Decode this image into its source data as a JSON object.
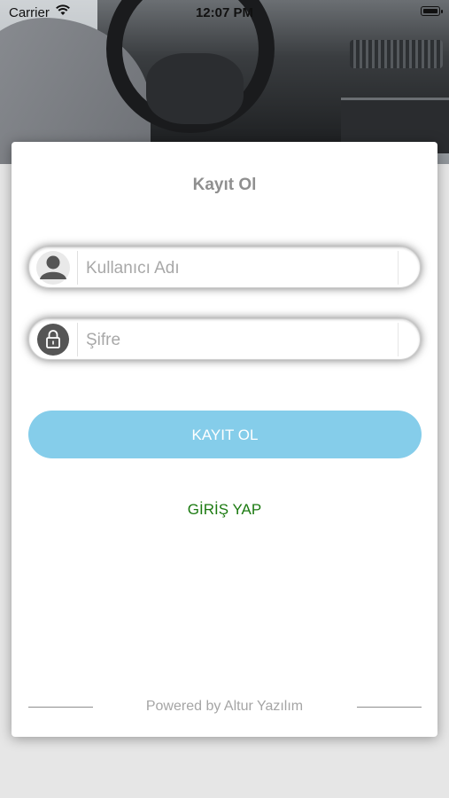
{
  "status_bar": {
    "carrier": "Carrier",
    "time": "12:07 PM",
    "wifi_icon": "wifi-icon",
    "battery_icon": "battery-icon"
  },
  "card": {
    "title": "Kayıt Ol",
    "username": {
      "placeholder": "Kullanıcı Adı",
      "value": "",
      "icon": "user-icon"
    },
    "password": {
      "placeholder": "Şifre",
      "value": "",
      "icon": "lock-icon"
    },
    "register_button": "KAYIT OL",
    "login_link": "GİRİŞ YAP",
    "footer_text": "Powered by Altur Yazılım"
  },
  "colors": {
    "button": "#85cdea",
    "link": "#1b7a10",
    "title": "#8f8f8f"
  }
}
